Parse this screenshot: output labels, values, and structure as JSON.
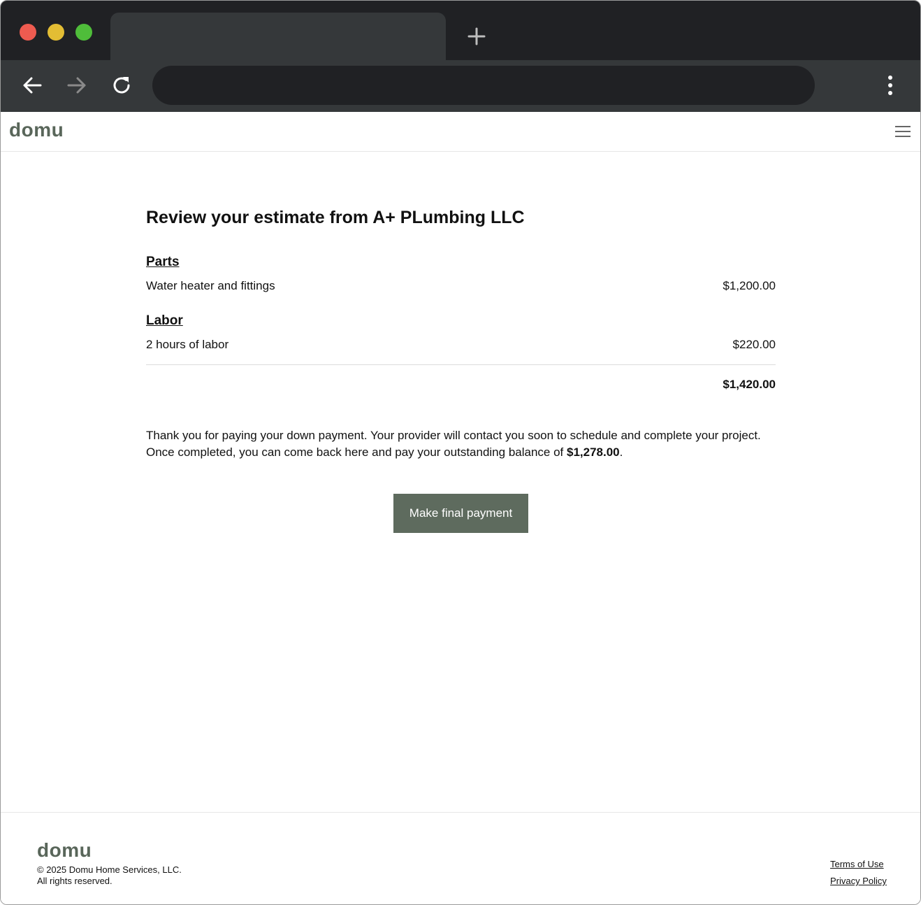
{
  "browser": {
    "tab_title": "",
    "address": ""
  },
  "header": {
    "logo": "domu"
  },
  "main": {
    "title_prefix": "Review your estimate from ",
    "provider_name": "A+ PLumbing LLC",
    "sections": [
      {
        "heading": "Parts",
        "item": "Water heater and fittings",
        "amount": "$1,200.00"
      },
      {
        "heading": "Labor",
        "item": "2 hours of labor",
        "amount": "$220.00"
      }
    ],
    "total": "$1,420.00",
    "message_line1": "Thank you for paying your down payment. Your provider will contact you soon to schedule and complete your project.",
    "message_line2_prefix": "Once completed, you can come back here and pay your outstanding balance of ",
    "outstanding_balance": "$1,278.00",
    "message_line2_suffix": ".",
    "pay_button_label": "Make final payment"
  },
  "footer": {
    "logo": "domu",
    "copyright": "© 2025 Domu Home Services, LLC.",
    "rights": "All rights reserved.",
    "terms_label": "Terms of Use",
    "privacy_label": "Privacy Policy"
  },
  "colors": {
    "brand": "#5e6b5e",
    "chrome_dark": "#202124",
    "chrome_mid": "#35383a"
  }
}
